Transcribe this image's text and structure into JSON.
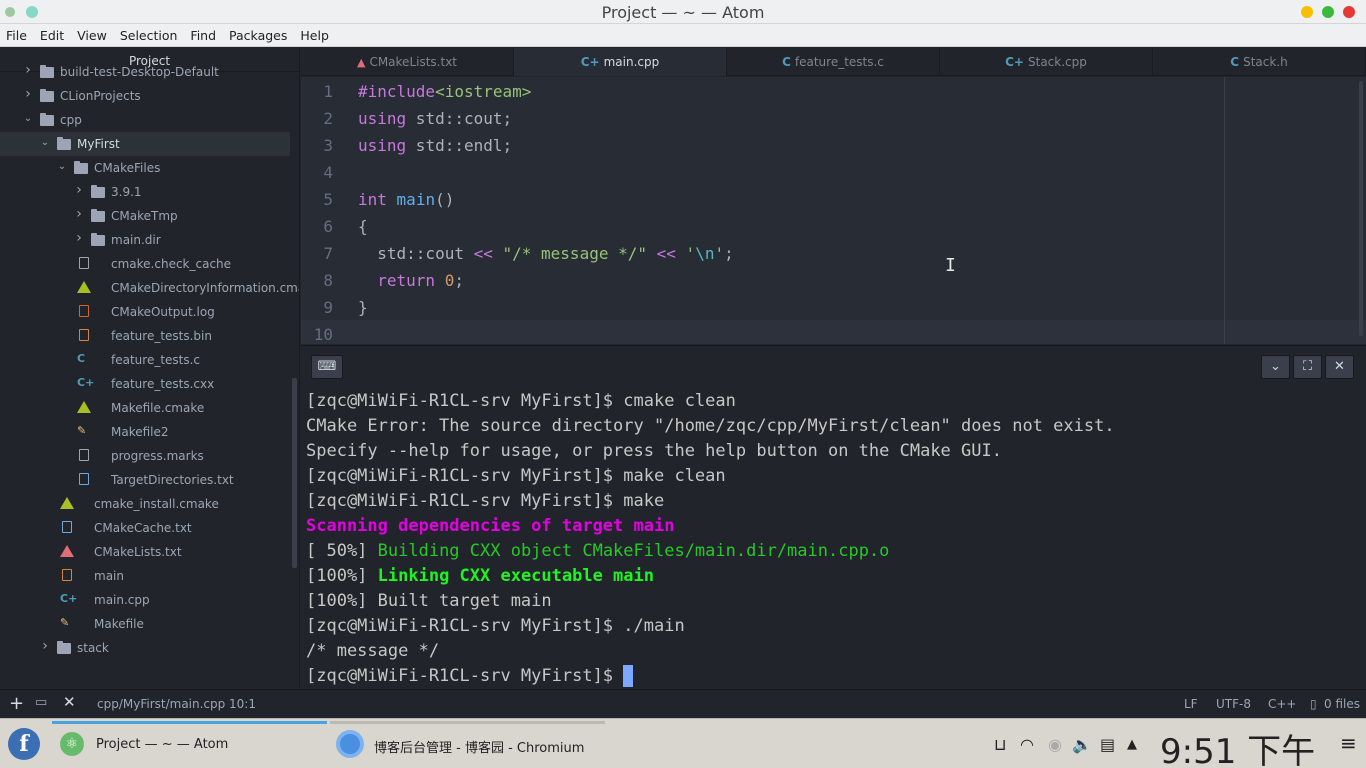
{
  "window": {
    "title": "Project — ~ — Atom"
  },
  "menu": [
    "File",
    "Edit",
    "View",
    "Selection",
    "Find",
    "Packages",
    "Help"
  ],
  "tree": {
    "header": "Project",
    "items": [
      {
        "label": "build-test-Desktop-Default",
        "type": "folder",
        "depth": 1,
        "expanded": false
      },
      {
        "label": "CLionProjects",
        "type": "folder",
        "depth": 1,
        "expanded": false
      },
      {
        "label": "cpp",
        "type": "folder",
        "depth": 1,
        "expanded": true
      },
      {
        "label": "MyFirst",
        "type": "folder",
        "depth": 2,
        "expanded": true,
        "selected": true
      },
      {
        "label": "CMakeFiles",
        "type": "folder",
        "depth": 3,
        "expanded": true
      },
      {
        "label": "3.9.1",
        "type": "folder",
        "depth": 4,
        "expanded": false
      },
      {
        "label": "CMakeTmp",
        "type": "folder",
        "depth": 4,
        "expanded": false
      },
      {
        "label": "main.dir",
        "type": "folder",
        "depth": 4,
        "expanded": false
      },
      {
        "label": "cmake.check_cache",
        "type": "file",
        "depth": 4,
        "icon": "file-icon"
      },
      {
        "label": "CMakeDirectoryInformation.cmake",
        "type": "file",
        "depth": 4,
        "icon": "cmake-icon"
      },
      {
        "label": "CMakeOutput.log",
        "type": "file",
        "depth": 4,
        "icon": "log-icon"
      },
      {
        "label": "feature_tests.bin",
        "type": "file",
        "depth": 4,
        "icon": "binary-icon"
      },
      {
        "label": "feature_tests.c",
        "type": "file",
        "depth": 4,
        "icon": "c-icon"
      },
      {
        "label": "feature_tests.cxx",
        "type": "file",
        "depth": 4,
        "icon": "cpp-icon"
      },
      {
        "label": "Makefile.cmake",
        "type": "file",
        "depth": 4,
        "icon": "cmake-icon"
      },
      {
        "label": "Makefile2",
        "type": "file",
        "depth": 4,
        "icon": "makefile-icon"
      },
      {
        "label": "progress.marks",
        "type": "file",
        "depth": 4,
        "icon": "file-icon"
      },
      {
        "label": "TargetDirectories.txt",
        "type": "file",
        "depth": 4,
        "icon": "text-icon"
      },
      {
        "label": "cmake_install.cmake",
        "type": "file",
        "depth": 3,
        "icon": "cmake-icon"
      },
      {
        "label": "CMakeCache.txt",
        "type": "file",
        "depth": 3,
        "icon": "text-icon"
      },
      {
        "label": "CMakeLists.txt",
        "type": "file",
        "depth": 3,
        "icon": "cmakelists-icon"
      },
      {
        "label": "main",
        "type": "file",
        "depth": 3,
        "icon": "binary-icon"
      },
      {
        "label": "main.cpp",
        "type": "file",
        "depth": 3,
        "icon": "cpp-icon"
      },
      {
        "label": "Makefile",
        "type": "file",
        "depth": 3,
        "icon": "makefile-icon"
      },
      {
        "label": "stack",
        "type": "folder",
        "depth": 2,
        "expanded": false
      }
    ]
  },
  "tabs": [
    {
      "label": "CMakeLists.txt",
      "icon": "cmakelists-icon",
      "active": false
    },
    {
      "label": "main.cpp",
      "icon": "cpp-icon",
      "active": true
    },
    {
      "label": "feature_tests.c",
      "icon": "c-icon",
      "active": false
    },
    {
      "label": "Stack.cpp",
      "icon": "cpp-icon",
      "active": false
    },
    {
      "label": "Stack.h",
      "icon": "c-icon",
      "active": false
    }
  ],
  "editor": {
    "line_numbers": [
      "1",
      "2",
      "3",
      "4",
      "5",
      "6",
      "7",
      "8",
      "9",
      "10"
    ]
  },
  "terminal": {
    "lines": [
      "[zqc@MiWiFi-R1CL-srv MyFirst]$ cmake clean",
      "CMake Error: The source directory \"/home/zqc/cpp/MyFirst/clean\" does not exist.",
      "Specify --help for usage, or press the help button on the CMake GUI.",
      "[zqc@MiWiFi-R1CL-srv MyFirst]$ make clean",
      "[zqc@MiWiFi-R1CL-srv MyFirst]$ make",
      "Scanning dependencies of target main",
      "[ 50%] ",
      "Building CXX object CMakeFiles/main.dir/main.cpp.o",
      "[100%] ",
      "Linking CXX executable main",
      "[100%] Built target main",
      "[zqc@MiWiFi-R1CL-srv MyFirst]$ ./main",
      "/* message */",
      "[zqc@MiWiFi-R1CL-srv MyFirst]$ "
    ]
  },
  "status": {
    "path": "cpp/MyFirst/main.cpp",
    "position": "10:1",
    "line_ending": "LF",
    "encoding": "UTF-8",
    "grammar": "C++",
    "git": "0 files"
  },
  "taskbar": {
    "tasks": [
      {
        "label": "Project — ~ — Atom",
        "icon": "atom-icon"
      },
      {
        "label": "博客后台管理 - 博客园 - Chromium",
        "icon": "chromium-icon"
      }
    ],
    "clock": "9:51 下午"
  },
  "colors": {
    "accent": "#4aa3df",
    "terminal_magenta": "#e300e3",
    "terminal_green": "#28c828"
  }
}
